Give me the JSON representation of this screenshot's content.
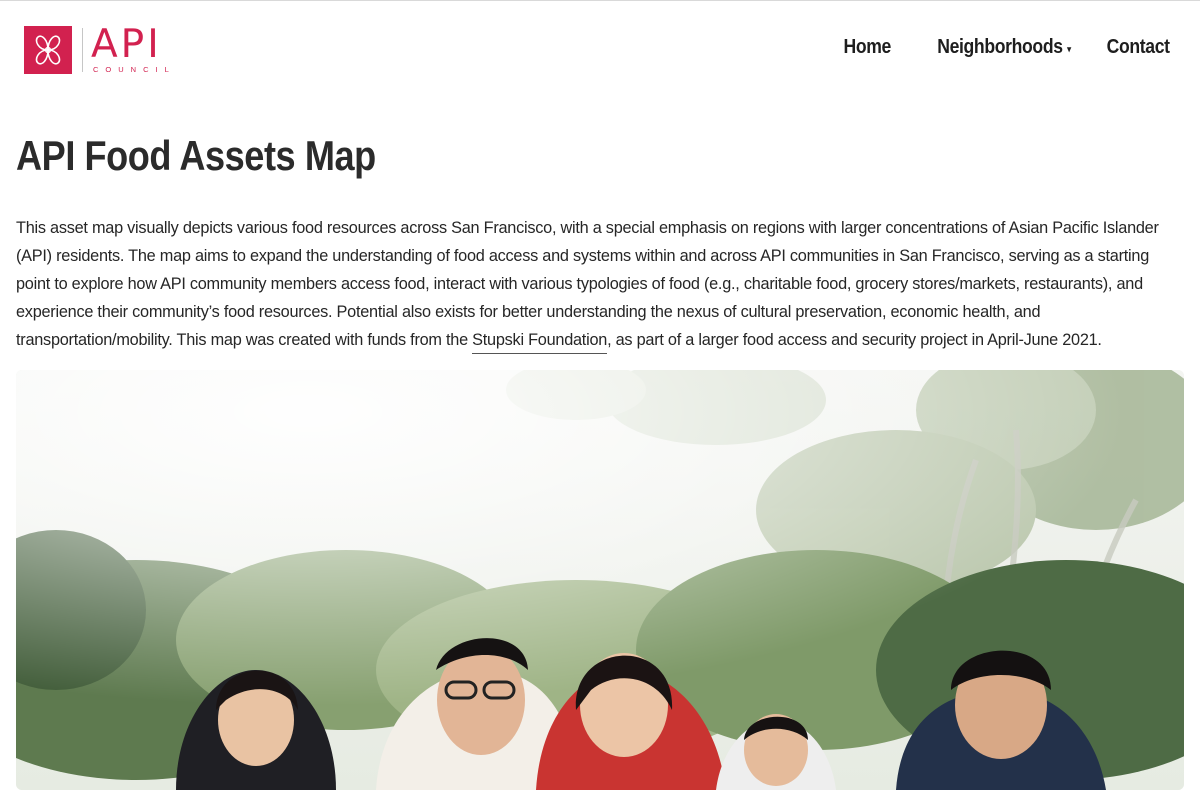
{
  "brand": {
    "logo_primary": "API",
    "logo_secondary": "COUNCIL",
    "color": "#d2214f"
  },
  "nav": {
    "items": [
      {
        "label": "Home"
      },
      {
        "label": "Neighborhoods",
        "has_dropdown": true
      },
      {
        "label": "Contact"
      }
    ],
    "caret": "▾"
  },
  "page": {
    "title": "API Food Assets Map",
    "intro_before_link": "This asset map visually depicts various food resources across San Francisco, with a special emphasis on regions with larger concentrations of Asian Pacific Islander (API) residents. The map aims to expand the understanding of food access and systems within and across API communities in San Francisco, serving as a starting point to explore how API community members access food, interact with various typologies of food (e.g., charitable food, grocery stores/markets, restaurants), and experience their community’s food resources. Potential also exists for better understanding the nexus of cultural preservation, economic health, and transportation/mobility. This map was created with funds from the ",
    "intro_link": "Stupski Foundation",
    "intro_after_link": ", as part of a larger food access and security project in April-June 2021."
  },
  "hero_image": {
    "subject": "five smiling people resting chins in hands outdoors under trees"
  }
}
